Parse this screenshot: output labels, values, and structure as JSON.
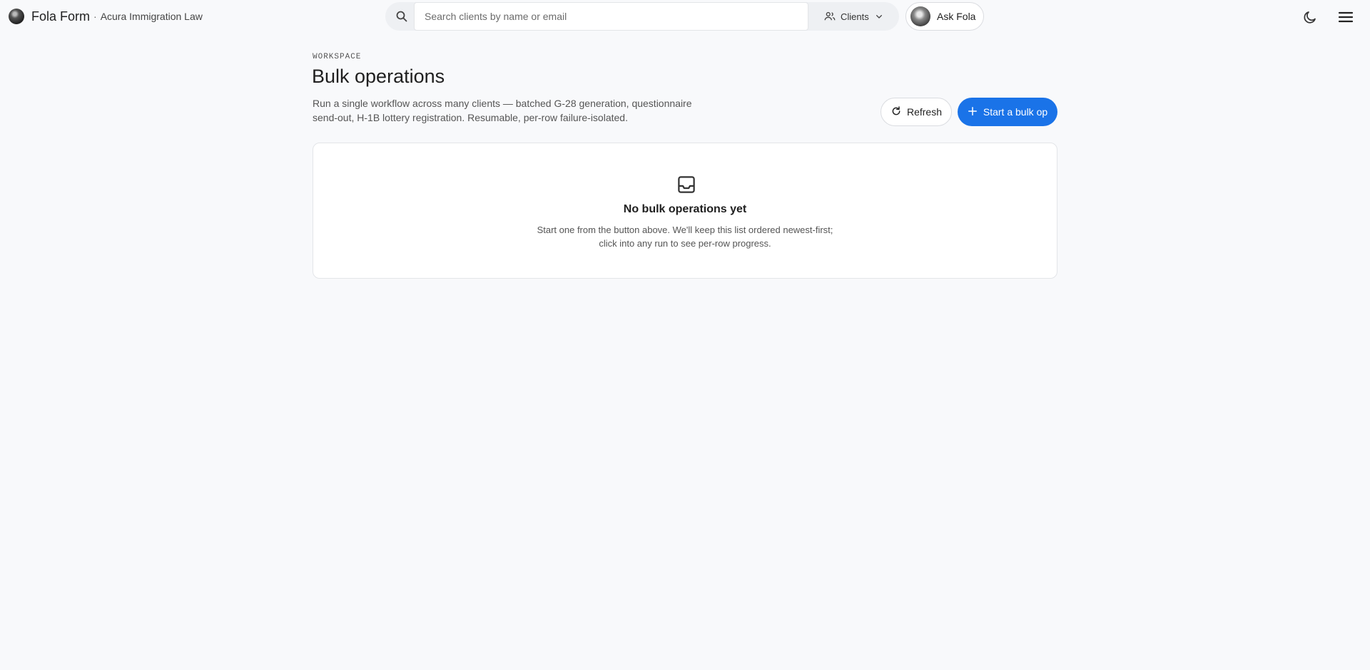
{
  "header": {
    "brand_name": "Fola Form",
    "separator": "·",
    "org_name": "Acura Immigration Law",
    "search": {
      "placeholder": "Search clients by name or email",
      "value": ""
    },
    "scope_label": "Clients",
    "ask_label": "Ask Fola"
  },
  "page": {
    "eyebrow": "WORKSPACE",
    "title": "Bulk operations",
    "description": "Run a single workflow across many clients — batched G-28 generation, questionnaire send-out, H-1B lottery registration. Resumable, per-row failure-isolated.",
    "actions": {
      "refresh_label": "Refresh",
      "start_label": "Start a bulk op"
    }
  },
  "empty_state": {
    "title": "No bulk operations yet",
    "line1": "Start one from the button above. We'll keep this list ordered newest-first;",
    "line2": "click into any run to see per-row progress."
  },
  "icons": {
    "search": "search-icon",
    "scope": "people-icon",
    "theme": "moon-icon",
    "menu": "menu-icon",
    "refresh": "refresh-icon",
    "add": "plus-icon",
    "empty": "inbox-icon"
  },
  "colors": {
    "accent": "#1a73e8",
    "background": "#f8f9fb"
  }
}
